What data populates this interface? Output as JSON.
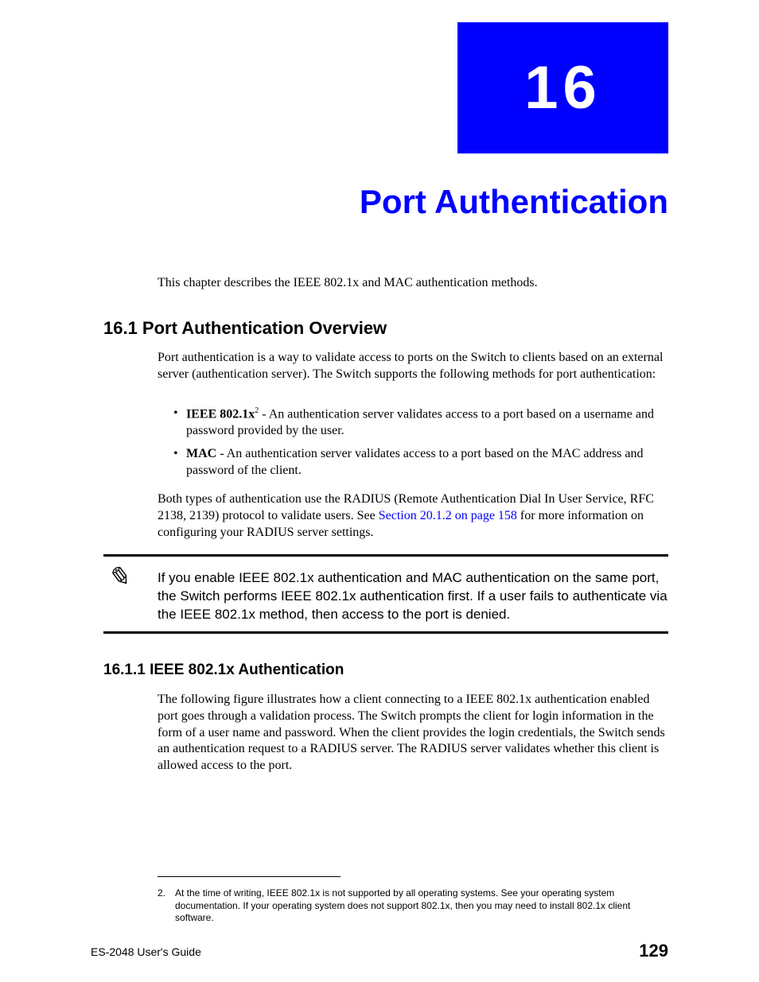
{
  "chapter": {
    "number": "16",
    "title": "Port Authentication"
  },
  "intro": "This chapter describes the IEEE 802.1x and MAC authentication methods.",
  "section1": {
    "heading": "16.1  Port Authentication Overview",
    "para1": "Port authentication is a way to validate access to ports on the Switch to clients based on an external server (authentication server). The Switch supports the following methods for port authentication:",
    "bullets": [
      {
        "label": "IEEE 802.1x",
        "sup": "2",
        "text": " - An authentication server validates access to a port based on a username and password provided by the user."
      },
      {
        "label": "MAC",
        "sup": "",
        "text": " - An authentication server validates access to a port based on the MAC address and password of the client."
      }
    ],
    "para2_a": "Both types of authentication use the RADIUS (Remote Authentication Dial In User Service, RFC 2138, 2139) protocol to validate users. See ",
    "para2_link": "Section 20.1.2 on page 158",
    "para2_b": " for more information on configuring your RADIUS server settings."
  },
  "note": {
    "text": "If you enable IEEE 802.1x authentication and MAC authentication on the same port, the Switch performs IEEE 802.1x authentication first. If a user fails to authenticate via the IEEE 802.1x method, then access to the port is denied."
  },
  "section2": {
    "heading": "16.1.1  IEEE 802.1x Authentication",
    "para": "The following figure illustrates how a client connecting to a IEEE 802.1x authentication enabled port goes through a validation process. The Switch prompts the client for login information in the form of a user name and password. When the client provides the login credentials, the Switch sends an authentication request to a RADIUS server. The RADIUS server validates whether this client is allowed access to the port."
  },
  "footnote": {
    "num": "2.",
    "text": "At the time of writing, IEEE 802.1x is not supported by all operating systems. See your operating system documentation. If your operating system does not support 802.1x, then you may need to install 802.1x client software."
  },
  "footer": {
    "left": "ES-2048 User's Guide",
    "right": "129"
  }
}
